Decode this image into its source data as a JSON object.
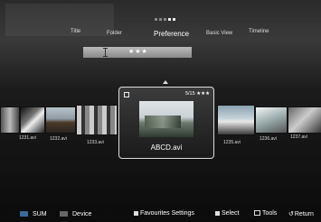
{
  "header": {
    "tabs": [
      {
        "label": "Title"
      },
      {
        "label": "Folder"
      },
      {
        "label": "Preference"
      },
      {
        "label": "Basic View"
      },
      {
        "label": "Timeline"
      }
    ],
    "sort_value": "★★★"
  },
  "thumbnails": [
    {
      "label": "1231.avi"
    },
    {
      "label": "1232.avi"
    },
    {
      "label": "1233.avi"
    },
    {
      "label": "1235.avi"
    },
    {
      "label": "1236.avi"
    },
    {
      "label": "1237.avi"
    }
  ],
  "focused": {
    "counter": "5/15 ★★★",
    "name": "ABCD.avi"
  },
  "footer": {
    "sources": [
      {
        "label": "SUM"
      },
      {
        "label": "Device"
      }
    ],
    "hints": {
      "favourites": "Favourites Settings",
      "select": "Select",
      "tools": "Tools",
      "return": "Return"
    }
  },
  "colors": {
    "sum_swatch": "#3a6a9a",
    "device_swatch": "#666666",
    "card_border": "#dddddd"
  }
}
